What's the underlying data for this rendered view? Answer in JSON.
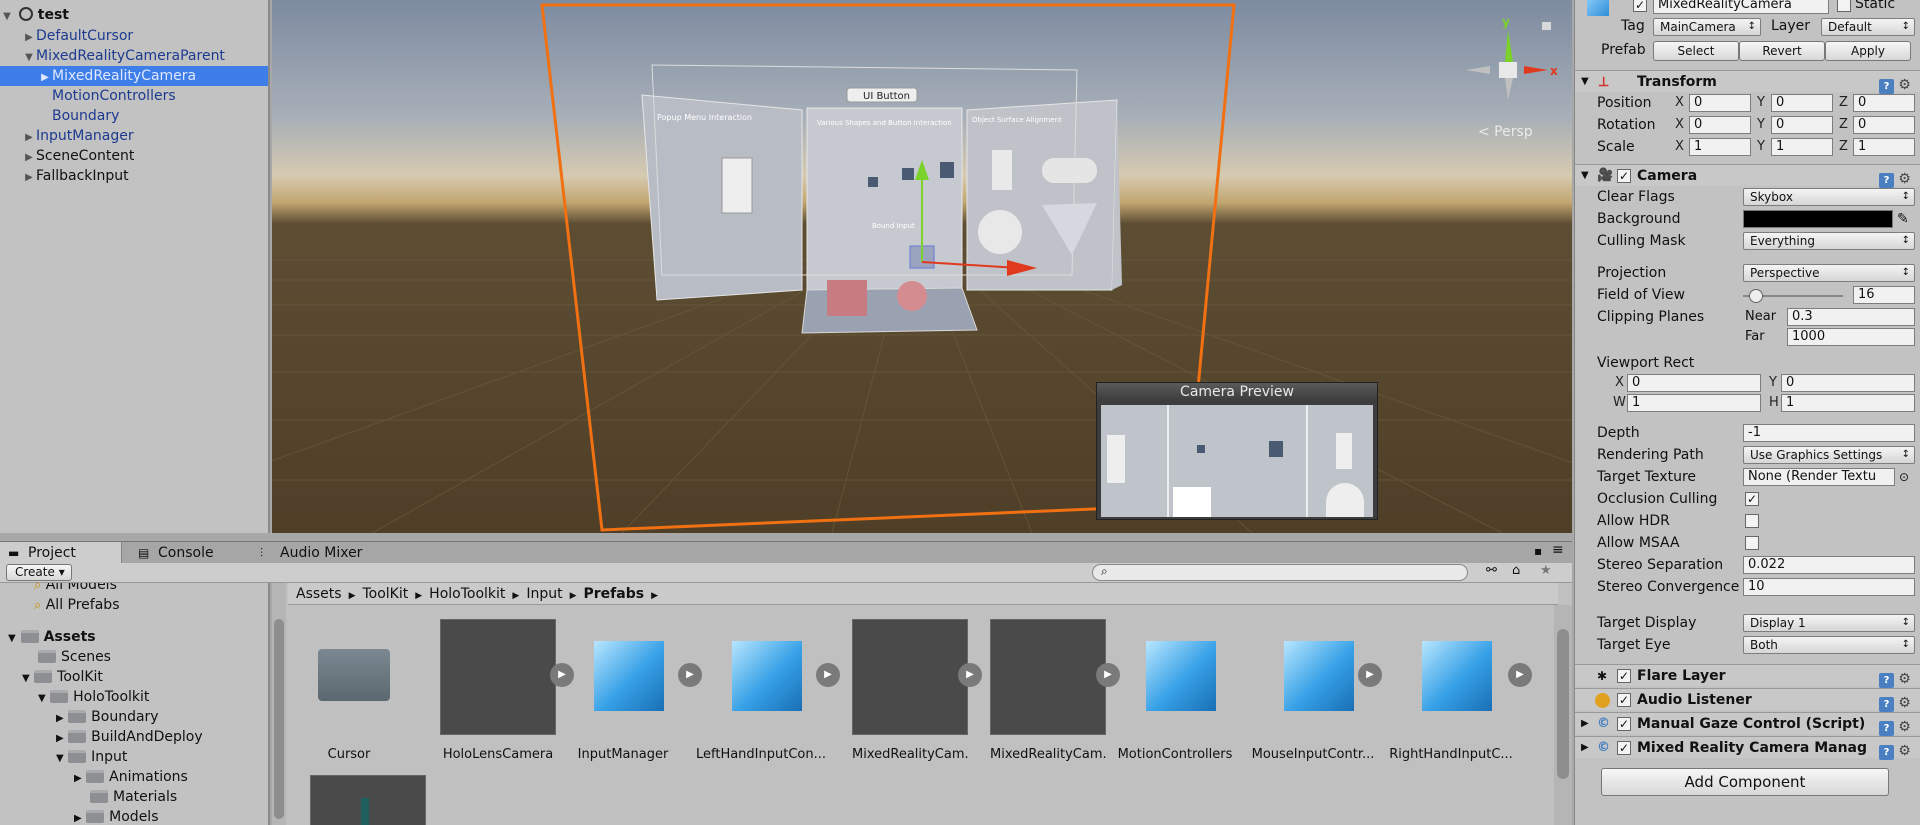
{
  "hierarchy": {
    "scene_name": "test",
    "items": [
      {
        "label": "DefaultCursor"
      },
      {
        "label": "MixedRealityCameraParent"
      },
      {
        "label": "MixedRealityCamera"
      },
      {
        "label": "MotionControllers"
      },
      {
        "label": "Boundary"
      },
      {
        "label": "InputManager"
      },
      {
        "label": "SceneContent"
      },
      {
        "label": "FallbackInput"
      }
    ]
  },
  "scene": {
    "persp_label": "< Persp",
    "gizmo": {
      "y": "y",
      "x": "x"
    },
    "panels": {
      "ui_button": "UI Button",
      "left": "Popup Menu Interaction",
      "center": "Various Shapes and Button interaction",
      "right": "Object Surface Alignment",
      "center_sub": "Bound Input"
    },
    "camera_preview_title": "Camera Preview"
  },
  "inspector": {
    "object_name": "MixedRealityCamera",
    "static_label": "Static",
    "tag_label": "Tag",
    "tag_value": "MainCamera",
    "layer_label": "Layer",
    "layer_value": "Default",
    "prefab_label": "Prefab",
    "prefab_buttons": [
      "Select",
      "Revert",
      "Apply"
    ],
    "transform": {
      "title": "Transform",
      "position": {
        "label": "Position",
        "x": "0",
        "y": "0",
        "z": "0"
      },
      "rotation": {
        "label": "Rotation",
        "x": "0",
        "y": "0",
        "z": "0"
      },
      "scale": {
        "label": "Scale",
        "x": "1",
        "y": "1",
        "z": "1"
      }
    },
    "camera": {
      "title": "Camera",
      "clear_flags": {
        "label": "Clear Flags",
        "value": "Skybox"
      },
      "background": {
        "label": "Background",
        "color": "#000000"
      },
      "culling_mask": {
        "label": "Culling Mask",
        "value": "Everything"
      },
      "projection": {
        "label": "Projection",
        "value": "Perspective"
      },
      "fov": {
        "label": "Field of View",
        "value": "16"
      },
      "clipping": {
        "label": "Clipping Planes",
        "near_label": "Near",
        "near": "0.3",
        "far_label": "Far",
        "far": "1000"
      },
      "viewport": {
        "label": "Viewport Rect",
        "x": "0",
        "y": "0",
        "w": "1",
        "h": "1"
      },
      "depth": {
        "label": "Depth",
        "value": "-1"
      },
      "rendering_path": {
        "label": "Rendering Path",
        "value": "Use Graphics Settings"
      },
      "target_texture": {
        "label": "Target Texture",
        "value": "None (Render Textu"
      },
      "occlusion_culling": {
        "label": "Occlusion Culling",
        "checked": true
      },
      "allow_hdr": {
        "label": "Allow HDR",
        "checked": false
      },
      "allow_msaa": {
        "label": "Allow MSAA",
        "checked": false
      },
      "stereo_separation": {
        "label": "Stereo Separation",
        "value": "0.022"
      },
      "stereo_convergence": {
        "label": "Stereo Convergence",
        "value": "10"
      },
      "target_display": {
        "label": "Target Display",
        "value": "Display 1"
      },
      "target_eye": {
        "label": "Target Eye",
        "value": "Both"
      }
    },
    "components": [
      "Flare Layer",
      "Audio Listener",
      "Manual Gaze Control (Script)",
      "Mixed Reality Camera Manag"
    ],
    "add_component": "Add Component"
  },
  "project": {
    "tabs": [
      "Project",
      "Console",
      "Audio Mixer"
    ],
    "create_label": "Create",
    "tree": {
      "favorites": [
        "All Models",
        "All Prefabs"
      ],
      "assets_label": "Assets",
      "items": [
        "Scenes",
        "ToolKit",
        "HoloToolkit",
        "Boundary",
        "BuildAndDeploy",
        "Input",
        "Animations",
        "Materials",
        "Models"
      ]
    },
    "breadcrumb": [
      "Assets",
      "ToolKit",
      "HoloToolkit",
      "Input",
      "Prefabs"
    ],
    "assets": [
      "Cursor",
      "HoloLensCamera",
      "InputManager",
      "LeftHandInputCon...",
      "MixedRealityCam...",
      "MixedRealityCam...",
      "MotionControllers",
      "MouseInputContr...",
      "RightHandInputC..."
    ]
  }
}
